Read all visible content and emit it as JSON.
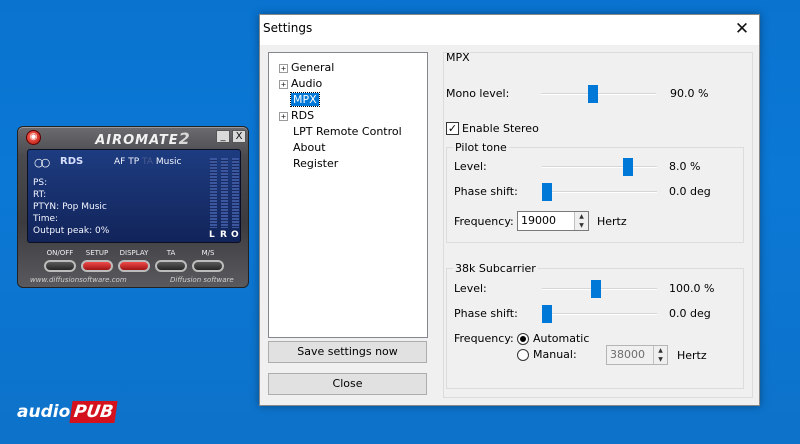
{
  "player": {
    "title": "AIROMATE",
    "version": "2",
    "logo_icon": "red-circle-logo-icon",
    "minimize_label": "_",
    "close_label": "X",
    "display": {
      "rds_logo": "RDS",
      "flags": {
        "af": "AF",
        "tp": "TP",
        "ta": "TA",
        "music": "Music"
      },
      "ps_label": "PS:",
      "rt_label": "RT:",
      "ptyn_label": "PTYN:",
      "ptyn_value": "Pop Music",
      "time_label": "Time:",
      "output_peak_label": "Output peak:",
      "output_peak_value": "0%",
      "meter_labels": [
        "L",
        "R",
        "O"
      ]
    },
    "controls": [
      {
        "label": "ON/OFF",
        "active": false
      },
      {
        "label": "SETUP",
        "active": true
      },
      {
        "label": "DISPLAY",
        "active": true
      },
      {
        "label": "TA",
        "active": false
      },
      {
        "label": "M/S",
        "active": false
      }
    ],
    "footer_url": "www.diffusionsoftware.com",
    "footer_brand": "Diffusion software"
  },
  "brand": {
    "audio": "audio",
    "pub": "PUB"
  },
  "dialog": {
    "title": "Settings",
    "close_label": "✕",
    "tree": [
      {
        "label": "General",
        "expander": "+",
        "selected": false
      },
      {
        "label": "Audio",
        "expander": "+",
        "selected": false
      },
      {
        "label": "MPX",
        "expander": "",
        "selected": true
      },
      {
        "label": "RDS",
        "expander": "+",
        "selected": false
      },
      {
        "label": "LPT Remote Control",
        "expander": "",
        "selected": false
      },
      {
        "label": "About",
        "expander": "",
        "selected": false
      },
      {
        "label": "Register",
        "expander": "",
        "selected": false
      }
    ],
    "save_label": "Save settings now",
    "close_button_label": "Close",
    "mpx": {
      "section_title": "MPX",
      "mono_level_label": "Mono level:",
      "mono_level_value": "90.0 %",
      "mono_level_fraction": 0.45,
      "enable_stereo_label": "Enable Stereo",
      "enable_stereo_checked": true,
      "pilot": {
        "title": "Pilot tone",
        "level_label": "Level:",
        "level_value": "8.0 %",
        "level_fraction": 0.77,
        "phase_label": "Phase shift:",
        "phase_value": "0.0 deg",
        "phase_fraction": 0.0,
        "frequency_label": "Frequency:",
        "frequency_value": "19000",
        "frequency_unit": "Hertz"
      },
      "subcarrier": {
        "title": "38k Subcarrier",
        "level_label": "Level:",
        "level_value": "100.0 %",
        "level_fraction": 0.47,
        "phase_label": "Phase shift:",
        "phase_value": "0.0 deg",
        "phase_fraction": 0.0,
        "frequency_label": "Frequency:",
        "automatic_label": "Automatic",
        "manual_label": "Manual:",
        "mode": "automatic",
        "manual_value": "38000",
        "frequency_unit": "Hertz"
      }
    }
  }
}
